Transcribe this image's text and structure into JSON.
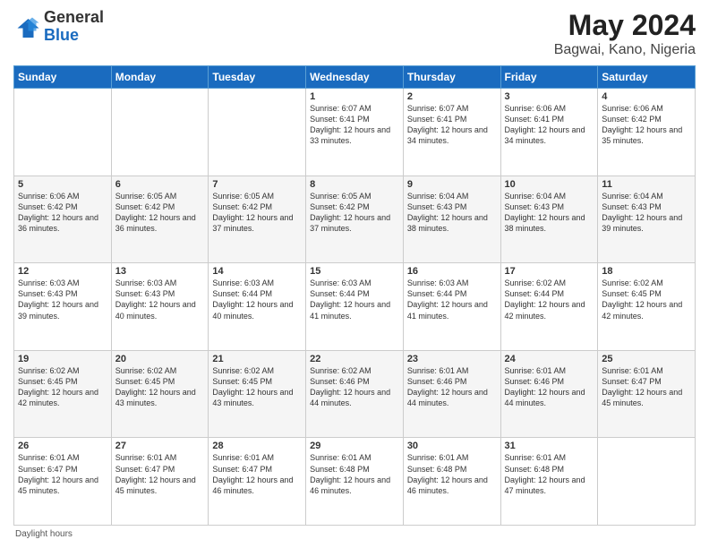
{
  "header": {
    "logo_general": "General",
    "logo_blue": "Blue",
    "main_title": "May 2024",
    "subtitle": "Bagwai, Kano, Nigeria"
  },
  "columns": [
    "Sunday",
    "Monday",
    "Tuesday",
    "Wednesday",
    "Thursday",
    "Friday",
    "Saturday"
  ],
  "weeks": [
    [
      {
        "day": "",
        "info": ""
      },
      {
        "day": "",
        "info": ""
      },
      {
        "day": "",
        "info": ""
      },
      {
        "day": "1",
        "info": "Sunrise: 6:07 AM\nSunset: 6:41 PM\nDaylight: 12 hours\nand 33 minutes."
      },
      {
        "day": "2",
        "info": "Sunrise: 6:07 AM\nSunset: 6:41 PM\nDaylight: 12 hours\nand 34 minutes."
      },
      {
        "day": "3",
        "info": "Sunrise: 6:06 AM\nSunset: 6:41 PM\nDaylight: 12 hours\nand 34 minutes."
      },
      {
        "day": "4",
        "info": "Sunrise: 6:06 AM\nSunset: 6:42 PM\nDaylight: 12 hours\nand 35 minutes."
      }
    ],
    [
      {
        "day": "5",
        "info": "Sunrise: 6:06 AM\nSunset: 6:42 PM\nDaylight: 12 hours\nand 36 minutes."
      },
      {
        "day": "6",
        "info": "Sunrise: 6:05 AM\nSunset: 6:42 PM\nDaylight: 12 hours\nand 36 minutes."
      },
      {
        "day": "7",
        "info": "Sunrise: 6:05 AM\nSunset: 6:42 PM\nDaylight: 12 hours\nand 37 minutes."
      },
      {
        "day": "8",
        "info": "Sunrise: 6:05 AM\nSunset: 6:42 PM\nDaylight: 12 hours\nand 37 minutes."
      },
      {
        "day": "9",
        "info": "Sunrise: 6:04 AM\nSunset: 6:43 PM\nDaylight: 12 hours\nand 38 minutes."
      },
      {
        "day": "10",
        "info": "Sunrise: 6:04 AM\nSunset: 6:43 PM\nDaylight: 12 hours\nand 38 minutes."
      },
      {
        "day": "11",
        "info": "Sunrise: 6:04 AM\nSunset: 6:43 PM\nDaylight: 12 hours\nand 39 minutes."
      }
    ],
    [
      {
        "day": "12",
        "info": "Sunrise: 6:03 AM\nSunset: 6:43 PM\nDaylight: 12 hours\nand 39 minutes."
      },
      {
        "day": "13",
        "info": "Sunrise: 6:03 AM\nSunset: 6:43 PM\nDaylight: 12 hours\nand 40 minutes."
      },
      {
        "day": "14",
        "info": "Sunrise: 6:03 AM\nSunset: 6:44 PM\nDaylight: 12 hours\nand 40 minutes."
      },
      {
        "day": "15",
        "info": "Sunrise: 6:03 AM\nSunset: 6:44 PM\nDaylight: 12 hours\nand 41 minutes."
      },
      {
        "day": "16",
        "info": "Sunrise: 6:03 AM\nSunset: 6:44 PM\nDaylight: 12 hours\nand 41 minutes."
      },
      {
        "day": "17",
        "info": "Sunrise: 6:02 AM\nSunset: 6:44 PM\nDaylight: 12 hours\nand 42 minutes."
      },
      {
        "day": "18",
        "info": "Sunrise: 6:02 AM\nSunset: 6:45 PM\nDaylight: 12 hours\nand 42 minutes."
      }
    ],
    [
      {
        "day": "19",
        "info": "Sunrise: 6:02 AM\nSunset: 6:45 PM\nDaylight: 12 hours\nand 42 minutes."
      },
      {
        "day": "20",
        "info": "Sunrise: 6:02 AM\nSunset: 6:45 PM\nDaylight: 12 hours\nand 43 minutes."
      },
      {
        "day": "21",
        "info": "Sunrise: 6:02 AM\nSunset: 6:45 PM\nDaylight: 12 hours\nand 43 minutes."
      },
      {
        "day": "22",
        "info": "Sunrise: 6:02 AM\nSunset: 6:46 PM\nDaylight: 12 hours\nand 44 minutes."
      },
      {
        "day": "23",
        "info": "Sunrise: 6:01 AM\nSunset: 6:46 PM\nDaylight: 12 hours\nand 44 minutes."
      },
      {
        "day": "24",
        "info": "Sunrise: 6:01 AM\nSunset: 6:46 PM\nDaylight: 12 hours\nand 44 minutes."
      },
      {
        "day": "25",
        "info": "Sunrise: 6:01 AM\nSunset: 6:47 PM\nDaylight: 12 hours\nand 45 minutes."
      }
    ],
    [
      {
        "day": "26",
        "info": "Sunrise: 6:01 AM\nSunset: 6:47 PM\nDaylight: 12 hours\nand 45 minutes."
      },
      {
        "day": "27",
        "info": "Sunrise: 6:01 AM\nSunset: 6:47 PM\nDaylight: 12 hours\nand 45 minutes."
      },
      {
        "day": "28",
        "info": "Sunrise: 6:01 AM\nSunset: 6:47 PM\nDaylight: 12 hours\nand 46 minutes."
      },
      {
        "day": "29",
        "info": "Sunrise: 6:01 AM\nSunset: 6:48 PM\nDaylight: 12 hours\nand 46 minutes."
      },
      {
        "day": "30",
        "info": "Sunrise: 6:01 AM\nSunset: 6:48 PM\nDaylight: 12 hours\nand 46 minutes."
      },
      {
        "day": "31",
        "info": "Sunrise: 6:01 AM\nSunset: 6:48 PM\nDaylight: 12 hours\nand 47 minutes."
      },
      {
        "day": "",
        "info": ""
      }
    ]
  ],
  "footer": {
    "note": "Daylight hours"
  },
  "colors": {
    "header_bg": "#1a6bbf",
    "header_text": "#ffffff",
    "row_even": "#f5f5f5",
    "row_odd": "#ffffff"
  }
}
